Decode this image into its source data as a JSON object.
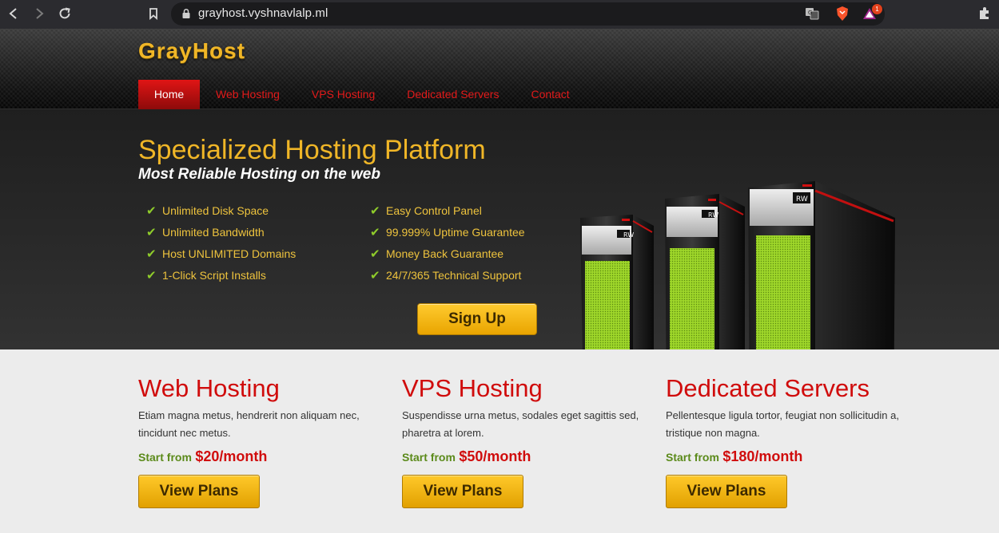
{
  "browser": {
    "url": "grayhost.vyshnavlalp.ml",
    "brave_badge_count": "1",
    "icons": [
      "back-icon",
      "forward-icon",
      "reload-icon",
      "bookmark-icon",
      "lock-icon",
      "translate-icon",
      "brave-shield-icon",
      "brave-rewards-icon",
      "extensions-icon"
    ]
  },
  "site": {
    "logo": "GrayHost",
    "nav": [
      {
        "label": "Home",
        "active": true
      },
      {
        "label": "Web Hosting",
        "active": false
      },
      {
        "label": "VPS Hosting",
        "active": false
      },
      {
        "label": "Dedicated Servers",
        "active": false
      },
      {
        "label": "Contact",
        "active": false
      }
    ]
  },
  "hero": {
    "title": "Specialized Hosting Platform",
    "subtitle": "Most Reliable Hosting on the web",
    "features_left": [
      "Unlimited Disk Space",
      "Unlimited Bandwidth",
      "Host UNLIMITED Domains",
      "1-Click Script Installs"
    ],
    "features_right": [
      "Easy Control Panel",
      "99.999% Uptime Guarantee",
      "Money Back Guarantee",
      "24/7/365 Technical Support"
    ],
    "signup_label": "Sign Up",
    "server_badge": "RW"
  },
  "plans": [
    {
      "title": "Web Hosting",
      "description": "Etiam magna metus, hendrerit non aliquam nec, tincidunt nec metus.",
      "price_label": "Start from",
      "price": "$20/month",
      "button": "View Plans"
    },
    {
      "title": "VPS Hosting",
      "description": "Suspendisse urna metus, sodales eget sagittis sed, pharetra at lorem.",
      "price_label": "Start from",
      "price": "$50/month",
      "button": "View Plans"
    },
    {
      "title": "Dedicated Servers",
      "description": "Pellentesque ligula tortor, feugiat non sollicitudin a, tristique non magna.",
      "price_label": "Start from",
      "price": "$180/month",
      "button": "View Plans"
    }
  ],
  "colors": {
    "accent_gold": "#f0b627",
    "nav_red": "#e21a1a",
    "check_green": "#8fcc2b",
    "price_green": "#5b8a1a",
    "title_red": "#d00c0c"
  }
}
